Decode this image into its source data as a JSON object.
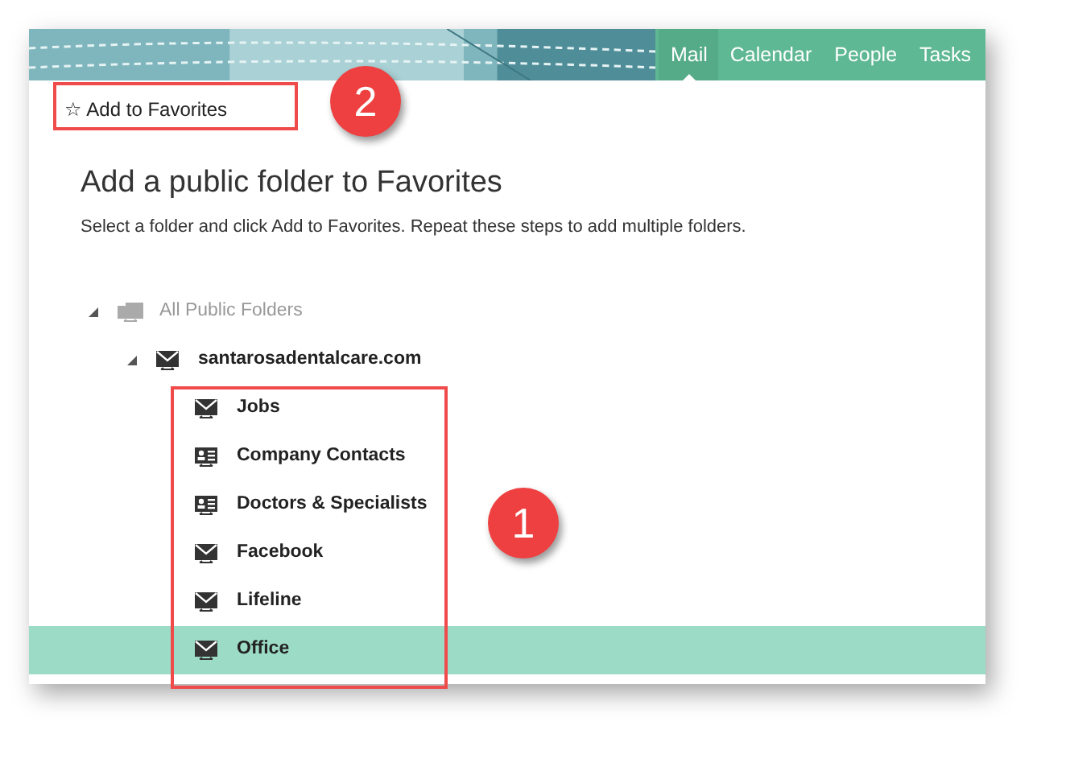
{
  "nav": {
    "tabs": [
      {
        "label": "Mail",
        "selected": true
      },
      {
        "label": "Calendar",
        "selected": false
      },
      {
        "label": "People",
        "selected": false
      },
      {
        "label": "Tasks",
        "selected": false
      }
    ]
  },
  "toolbar": {
    "add_button": "☆ Add to Favorites"
  },
  "heading": "Add a public folder to Favorites",
  "instructions": "Select a folder and click Add to Favorites. Repeat these steps to add multiple folders.",
  "tree": [
    {
      "label": "All Public Folders",
      "kind": "root",
      "expanded": true,
      "children": [
        {
          "label": "santarosadentalcare.com",
          "kind": "mail",
          "expanded": true,
          "children": [
            {
              "label": "Jobs",
              "kind": "mail",
              "selected": false
            },
            {
              "label": "Company Contacts",
              "kind": "contacts",
              "selected": false
            },
            {
              "label": "Doctors & Specialists",
              "kind": "contacts",
              "selected": false
            },
            {
              "label": "Facebook",
              "kind": "mail",
              "selected": false
            },
            {
              "label": "Lifeline",
              "kind": "mail",
              "selected": false
            },
            {
              "label": "Office",
              "kind": "mail",
              "selected": true
            }
          ]
        }
      ]
    }
  ],
  "callouts": [
    {
      "number": "2"
    },
    {
      "number": "1"
    }
  ]
}
